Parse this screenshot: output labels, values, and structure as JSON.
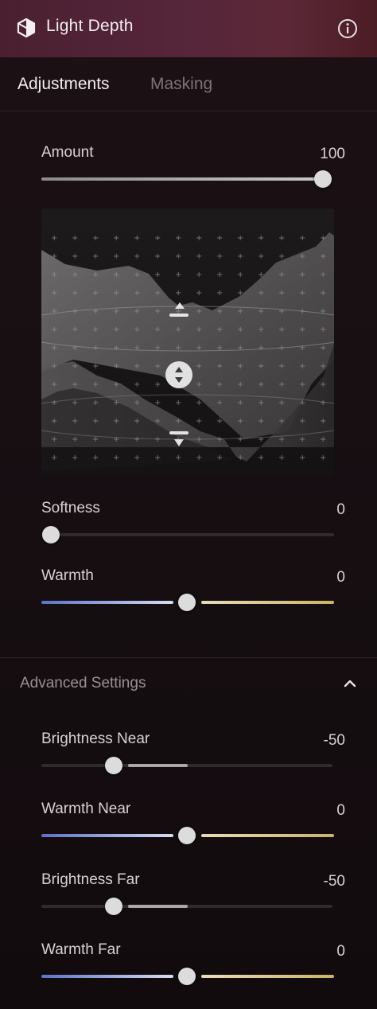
{
  "header": {
    "title": "Light Depth",
    "logo_icon": "cube-icon",
    "info_icon": "info-icon"
  },
  "tabs": [
    {
      "label": "Adjustments",
      "active": true
    },
    {
      "label": "Masking",
      "active": false
    }
  ],
  "sliders": {
    "amount": {
      "label": "Amount",
      "value": "100",
      "level": 1.0
    },
    "softness": {
      "label": "Softness",
      "value": "0",
      "level": 0.0
    },
    "warmth": {
      "label": "Warmth",
      "value": "0",
      "level": 0.5
    }
  },
  "advanced": {
    "title": "Advanced Settings",
    "expanded": true,
    "sliders": {
      "brightness_near": {
        "label": "Brightness Near",
        "value": "-50",
        "level": 0.25
      },
      "warmth_near": {
        "label": "Warmth Near",
        "value": "0",
        "level": 0.5
      },
      "brightness_far": {
        "label": "Brightness Far",
        "value": "-50",
        "level": 0.25
      },
      "warmth_far": {
        "label": "Warmth Far",
        "value": "0",
        "level": 0.5
      }
    }
  },
  "colors": {
    "cool": "#5a72c8",
    "warm": "#c9b36a",
    "accent": "#55253a"
  }
}
